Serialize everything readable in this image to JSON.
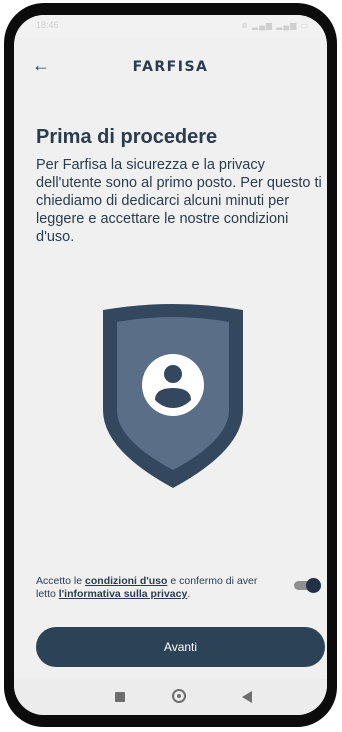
{
  "status_bar": {
    "time": "18:46",
    "icons": "⊗ ▂▄▆ ▂▄▆ ▭"
  },
  "header": {
    "back_icon": "arrow-left-icon",
    "logo_text": "FARFISA"
  },
  "content": {
    "title": "Prima di procedere",
    "intro": "Per Farfisa la sicurezza e la privacy dell'utente sono al primo posto. Per questo ti chiediamo di dedicarci alcuni minuti per leggere e accettare le nostre condizioni d'uso."
  },
  "illustration": {
    "icon": "shield-user-icon",
    "colors": {
      "outer": "#33475e",
      "inner": "#5a6f87",
      "circle": "#ffffff",
      "person": "#33475e"
    }
  },
  "consent": {
    "text_before": "Accetto le ",
    "link_terms": "condizioni d'uso",
    "text_middle": " e confermo di aver letto ",
    "link_privacy": "l'informativa sulla privacy",
    "text_after": ".",
    "toggle_on": true
  },
  "cta": {
    "label": "Avanti"
  },
  "nav_bar": {
    "recent_icon": "square-icon",
    "home_icon": "circle-home-icon",
    "back_icon": "triangle-back-icon"
  },
  "colors": {
    "primary": "#2c4257",
    "text": "#2b3c4f",
    "background": "#f0f0f0"
  }
}
